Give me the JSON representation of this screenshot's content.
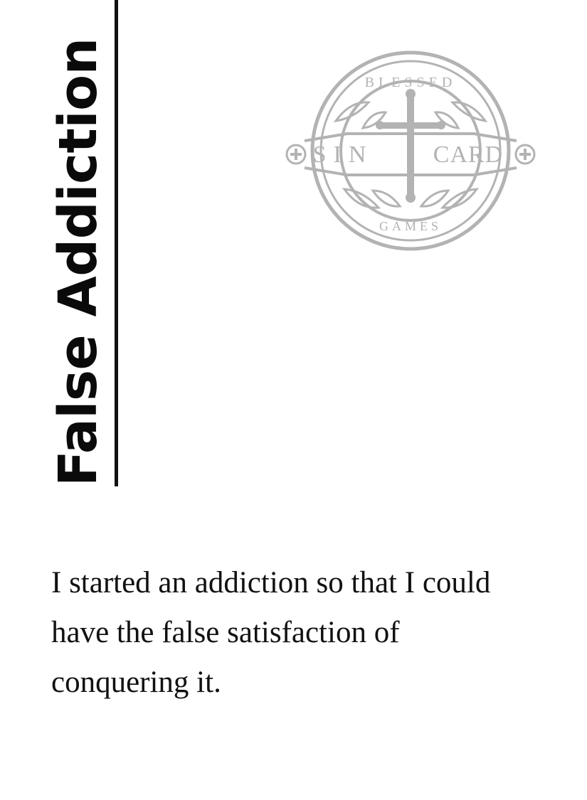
{
  "card": {
    "title": "False Addiction",
    "text": "I started an addiction so that I could have the false satisfaction of conquering it."
  },
  "logo": {
    "top_text": "BLESSED",
    "left_text": "SIN",
    "right_text": "CARD",
    "bottom_text": "GAMES",
    "color": "#b3b3b3"
  }
}
